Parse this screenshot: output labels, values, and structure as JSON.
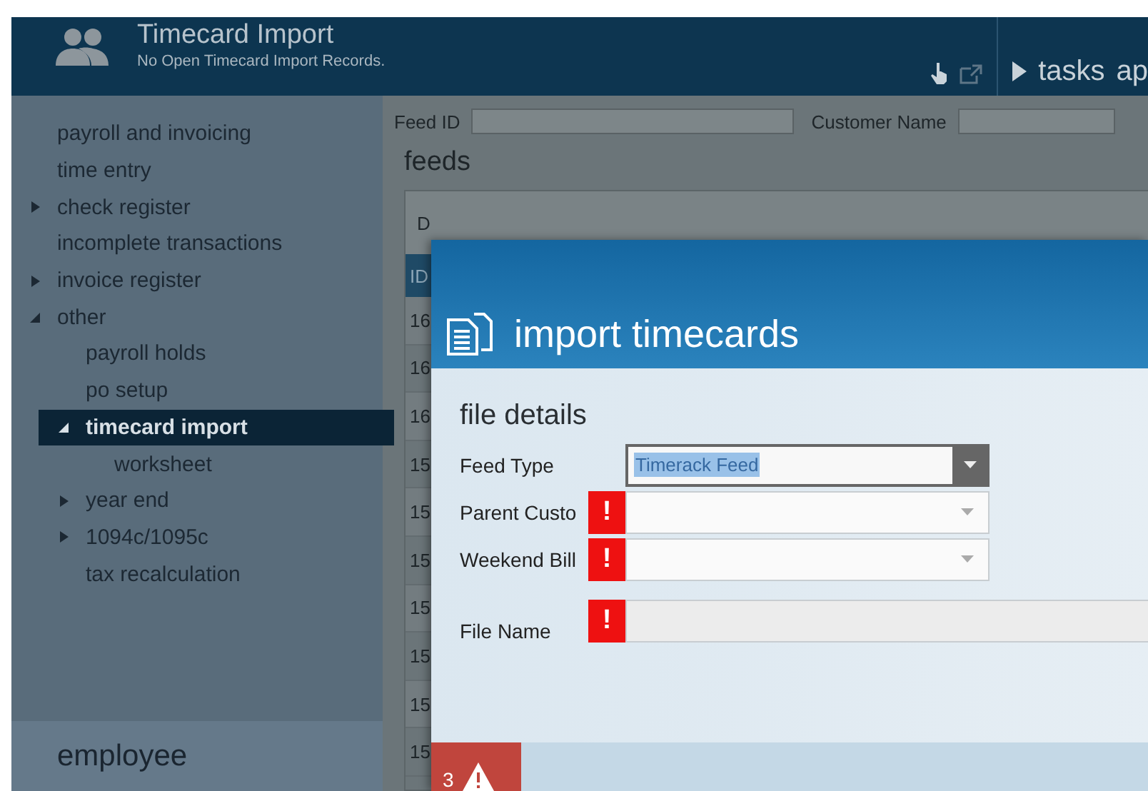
{
  "header": {
    "title": "Timecard Import",
    "subtitle": "No Open Timecard Import Records.",
    "tasks_label": "tasks",
    "next_menu": "ap"
  },
  "sidebar": {
    "items": [
      {
        "label": "payroll and invoicing",
        "kind": "leaf",
        "selected": false
      },
      {
        "label": "time entry",
        "kind": "leaf",
        "selected": false
      },
      {
        "label": "check register",
        "kind": "branch",
        "expanded": false,
        "selected": false
      },
      {
        "label": "incomplete transactions",
        "kind": "leaf",
        "selected": false
      },
      {
        "label": "invoice register",
        "kind": "branch",
        "expanded": false,
        "selected": false
      },
      {
        "label": "other",
        "kind": "branch",
        "expanded": true,
        "selected": false,
        "children": [
          {
            "label": "payroll holds",
            "kind": "leaf",
            "selected": false
          },
          {
            "label": "po setup",
            "kind": "leaf",
            "selected": false
          },
          {
            "label": "timecard import",
            "kind": "branch",
            "expanded": true,
            "selected": true,
            "children": [
              {
                "label": "worksheet",
                "kind": "leaf",
                "selected": false
              }
            ]
          },
          {
            "label": "year end",
            "kind": "branch",
            "expanded": false,
            "selected": false
          },
          {
            "label": "1094c/1095c",
            "kind": "branch",
            "expanded": false,
            "selected": false
          },
          {
            "label": "tax recalculation",
            "kind": "leaf",
            "selected": false
          }
        ]
      }
    ],
    "footer": "employee"
  },
  "filters": [
    {
      "label": "Feed ID"
    },
    {
      "label": "Customer Name"
    }
  ],
  "feeds": {
    "title": "feeds",
    "toolbar_text": "D",
    "columns": [
      "ID"
    ],
    "rows": [
      "16",
      "16",
      "16",
      "15",
      "15",
      "15",
      "15",
      "15",
      "15",
      "15"
    ]
  },
  "dialog": {
    "title": "import timecards",
    "section": "file details",
    "fields": [
      {
        "label": "Feed Type",
        "kind": "dropdown",
        "value": "Timerack Feed",
        "value_selected": true
      },
      {
        "label": "Parent Custo",
        "kind": "combo",
        "error_mark": "!"
      },
      {
        "label": "Weekend Bill",
        "kind": "combo",
        "error_mark": "!"
      },
      {
        "label": "File Name",
        "kind": "text",
        "error_mark": "!"
      }
    ],
    "error_count": "3"
  }
}
